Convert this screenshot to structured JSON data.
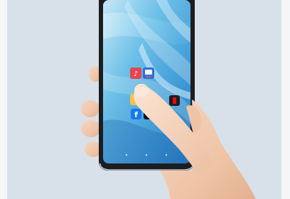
{
  "photo": {
    "subject": "hand-holding-smartphone",
    "background_color": "#d8e1ea",
    "phone_frame_color": "#1c1d21",
    "screen_gradient": [
      "#bfe3f2",
      "#5ab4e2",
      "#2c7fc3"
    ],
    "skin_color": "#f1cbb1"
  },
  "app_icons": [
    {
      "name": "music-app-icon",
      "color": "#e84352"
    },
    {
      "name": "gallery-app-icon",
      "color": "#2e6fd8"
    },
    {
      "name": "notes-app-icon",
      "color": "#f3c248"
    },
    {
      "name": "video-app-icon",
      "color": "#1d1d1f"
    },
    {
      "name": "facebook-app-icon",
      "color": "#1877f2"
    },
    {
      "name": "tiktok-app-icon",
      "color": "#111111"
    }
  ]
}
